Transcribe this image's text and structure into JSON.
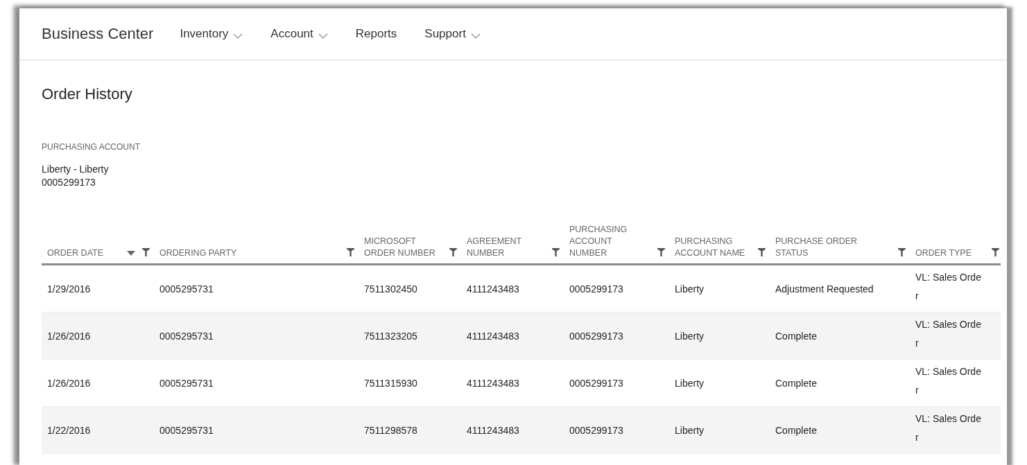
{
  "header": {
    "brand": "Business Center",
    "nav": [
      {
        "label": "Inventory",
        "has_menu": true
      },
      {
        "label": "Account",
        "has_menu": true
      },
      {
        "label": "Reports",
        "has_menu": false
      },
      {
        "label": "Support",
        "has_menu": true
      }
    ]
  },
  "page": {
    "title": "Order History",
    "account_label": "PURCHASING ACCOUNT",
    "account_name": "Liberty - Liberty",
    "account_number": "0005299173"
  },
  "table": {
    "columns": [
      {
        "label": "ORDER DATE",
        "sorted": true
      },
      {
        "label": "ORDERING PARTY",
        "sorted": false
      },
      {
        "label": "MICROSOFT ORDER NUMBER",
        "sorted": false
      },
      {
        "label": "AGREEMENT NUMBER",
        "sorted": false
      },
      {
        "label": "PURCHASING ACCOUNT NUMBER",
        "sorted": false
      },
      {
        "label": "PURCHASING ACCOUNT NAME",
        "sorted": false
      },
      {
        "label": "PURCHASE ORDER STATUS",
        "sorted": false
      },
      {
        "label": "ORDER TYPE",
        "sorted": false
      }
    ],
    "rows": [
      [
        "1/29/2016",
        "0005295731",
        "7511302450",
        "4111243483",
        "0005299173",
        "Liberty",
        "Adjustment Requested",
        "VL: Sales Order"
      ],
      [
        "1/26/2016",
        "0005295731",
        "7511323205",
        "4111243483",
        "0005299173",
        "Liberty",
        "Complete",
        "VL: Sales Order"
      ],
      [
        "1/26/2016",
        "0005295731",
        "7511315930",
        "4111243483",
        "0005299173",
        "Liberty",
        "Complete",
        "VL: Sales Order"
      ],
      [
        "1/22/2016",
        "0005295731",
        "7511298578",
        "4111243483",
        "0005299173",
        "Liberty",
        "Complete",
        "VL: Sales Order"
      ]
    ]
  }
}
